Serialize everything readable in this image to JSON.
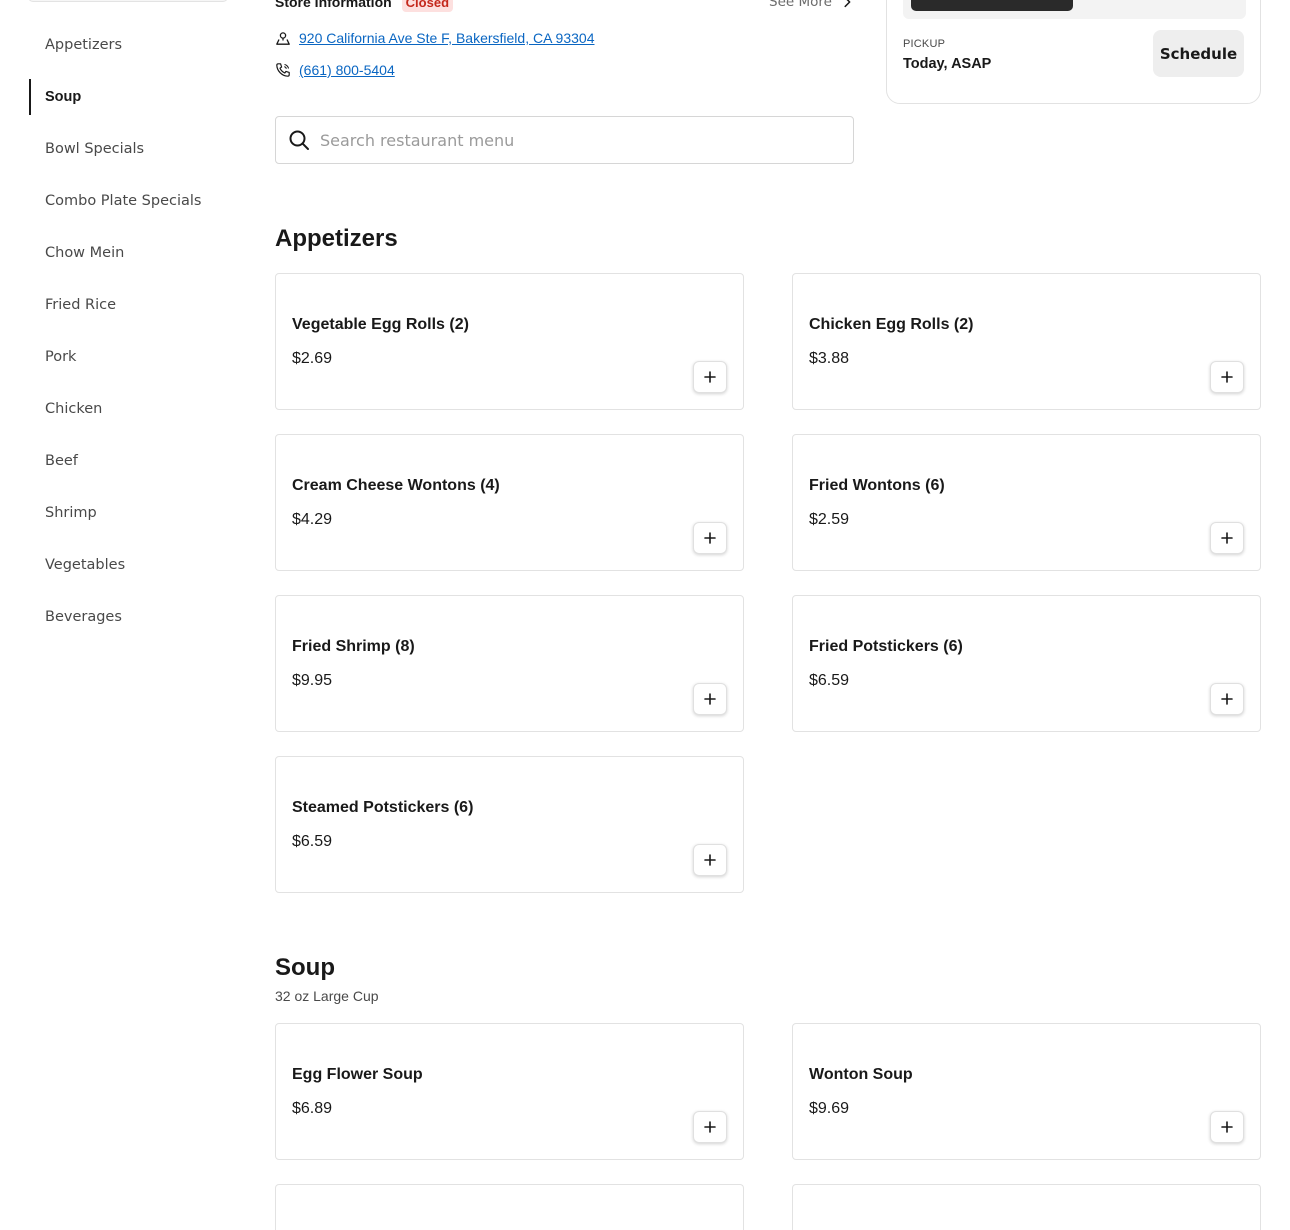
{
  "sidebar": {
    "categories": [
      {
        "label": "Appetizers",
        "active": false
      },
      {
        "label": "Soup",
        "active": true
      },
      {
        "label": "Bowl Specials",
        "active": false
      },
      {
        "label": "Combo Plate Specials",
        "active": false
      },
      {
        "label": "Chow Mein",
        "active": false
      },
      {
        "label": "Fried Rice",
        "active": false
      },
      {
        "label": "Pork",
        "active": false
      },
      {
        "label": "Chicken",
        "active": false
      },
      {
        "label": "Beef",
        "active": false
      },
      {
        "label": "Shrimp",
        "active": false
      },
      {
        "label": "Vegetables",
        "active": false
      },
      {
        "label": "Beverages",
        "active": false
      }
    ]
  },
  "store": {
    "title": "Store Information",
    "status": "Closed",
    "see_more": "See More",
    "address": "920 California Ave Ste F, Bakersfield, CA 93304",
    "phone": "(661) 800-5404"
  },
  "search": {
    "placeholder": "Search restaurant menu",
    "value": ""
  },
  "pickup": {
    "label": "PICKUP",
    "time": "Today, ASAP",
    "schedule_label": "Schedule"
  },
  "sections": {
    "appetizers": {
      "title": "Appetizers",
      "items": [
        {
          "name": "Vegetable Egg Rolls (2)",
          "price": "$2.69"
        },
        {
          "name": "Chicken Egg Rolls (2)",
          "price": "$3.88"
        },
        {
          "name": "Cream Cheese Wontons (4)",
          "price": "$4.29"
        },
        {
          "name": "Fried Wontons (6)",
          "price": "$2.59"
        },
        {
          "name": "Fried Shrimp (8)",
          "price": "$9.95"
        },
        {
          "name": "Fried Potstickers (6)",
          "price": "$6.59"
        },
        {
          "name": "Steamed Potstickers (6)",
          "price": "$6.59"
        }
      ]
    },
    "soup": {
      "title": "Soup",
      "subtitle": "32 oz Large Cup",
      "items": [
        {
          "name": "Egg Flower Soup",
          "price": "$6.89"
        },
        {
          "name": "Wonton Soup",
          "price": "$9.69"
        },
        {
          "name": "",
          "price": ""
        },
        {
          "name": "",
          "price": ""
        }
      ]
    }
  },
  "colors": {
    "link": "#0a66c2",
    "closed_bg": "#fde0df",
    "closed_text": "#c4281c",
    "border": "#e2e2e2"
  },
  "icons": {
    "address": "location-pin-icon",
    "phone": "phone-icon",
    "search": "search-icon",
    "see_more": "chevron-right-icon",
    "add": "plus-icon"
  }
}
